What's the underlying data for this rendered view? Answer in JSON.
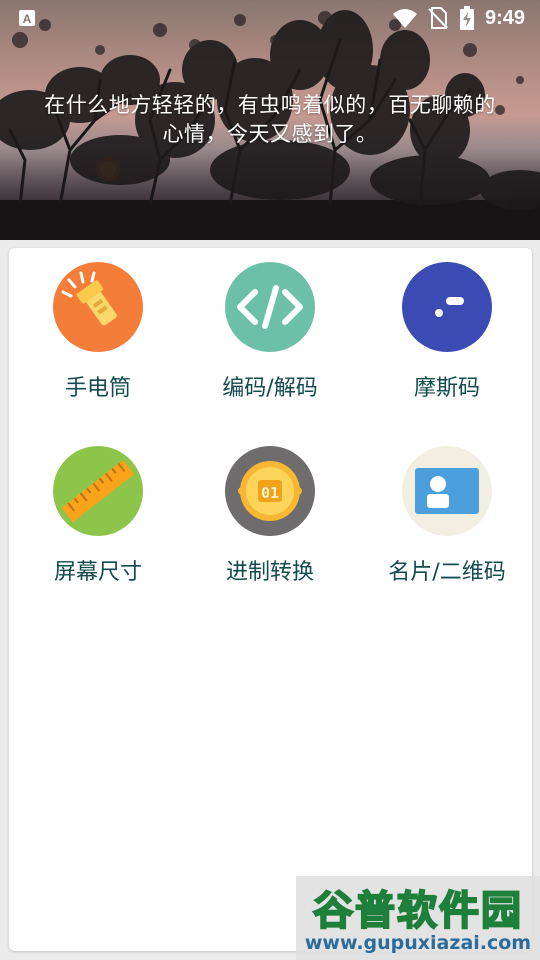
{
  "status_bar": {
    "time": "9:49",
    "icons": [
      "app-notification-icon",
      "wifi-icon",
      "no-sim-icon",
      "battery-charging-icon"
    ]
  },
  "banner": {
    "quote_line1": "在什么地方轻轻的，有虫鸣着似的，百无聊赖的",
    "quote_line2": "心情，今天又感到了。"
  },
  "tools": [
    {
      "label": "手电筒",
      "icon": "flashlight-icon",
      "color": "#f47d3a"
    },
    {
      "label": "编码/解码",
      "icon": "code-icon",
      "color": "#6dc0a8"
    },
    {
      "label": "摩斯码",
      "icon": "morse-icon",
      "color": "#3c4bb4"
    },
    {
      "label": "屏幕尺寸",
      "icon": "ruler-icon",
      "color": "#8dc44a"
    },
    {
      "label": "进制转换",
      "icon": "binary-coin-icon",
      "color": "#6e6c6c"
    },
    {
      "label": "名片/二维码",
      "icon": "business-card-icon",
      "color": "#f2eee2"
    }
  ],
  "watermark": {
    "title": "谷普软件园",
    "url": "www.gupuxiazai.com"
  }
}
